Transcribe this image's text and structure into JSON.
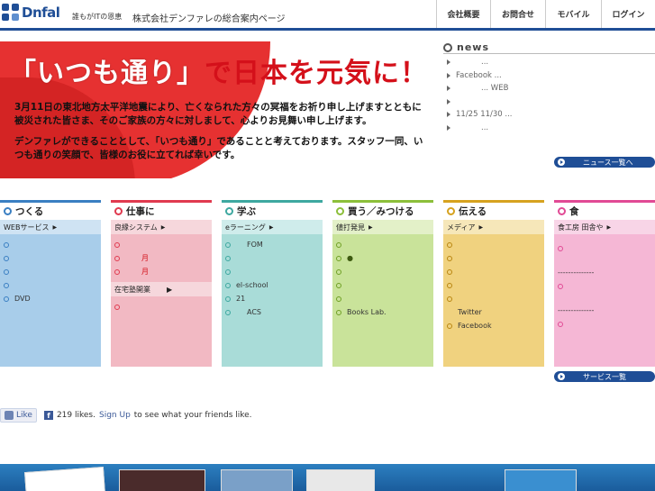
{
  "header": {
    "logo_text": "Dnfal",
    "tagline": "誰もがITの恩恵",
    "site_title": "株式会社デンファレの総合案内ページ",
    "nav": [
      "会社概要",
      "お問合せ",
      "モバイル",
      "ログイン"
    ]
  },
  "hero": {
    "headline_quote": "「いつも通り」",
    "headline_rest": "で日本を元気に！",
    "paragraphs": [
      "3月11日の東北地方太平洋地震により、亡くなられた方々の冥福をお祈り申し上げますとともに被災された皆さま、そのご家族の方々に対しまして、心よりお見舞い申し上げます。",
      "デンファレができることとして、「いつも通り」であることと考えております。スタッフ一同、いつも通りの笑顔で、皆様のお役に立てれば幸いです。"
    ]
  },
  "news": {
    "title": "news",
    "items": [
      "...",
      "Facebook ...",
      "... WEB",
      "",
      "11/25 11/30 ...",
      "..."
    ],
    "more_label": "ニュース一覧へ"
  },
  "columns": [
    {
      "title": "つくる",
      "accent": "#3a7fc2",
      "sub_bg": "#cfe3f3",
      "body_bg": "#a8cdea",
      "sub": "WEBサービス",
      "items": [
        "",
        "",
        "",
        "",
        "DVD"
      ]
    },
    {
      "title": "仕事に",
      "accent": "#e03a4f",
      "sub_bg": "#f6d7dc",
      "body_bg": "#f2b9c3",
      "sub": "良縁システム",
      "items": [
        "",
        "月",
        "月"
      ],
      "sub2": "在宅塾開業",
      "items2": [
        ""
      ]
    },
    {
      "title": "学ぶ",
      "accent": "#3ea8a0",
      "sub_bg": "#cfeceb",
      "body_bg": "#a9dcd8",
      "sub": "eラーニング",
      "items": [
        "FOM",
        "",
        "",
        "el-school",
        "21",
        "ACS"
      ]
    },
    {
      "title": "買う／みつける",
      "accent": "#8cbf3a",
      "sub_bg": "#e3f0c8",
      "body_bg": "#c9e39a",
      "sub": "値打発見",
      "items": [
        "",
        "●",
        "",
        "",
        "",
        "Books Lab."
      ]
    },
    {
      "title": "伝える",
      "accent": "#d6a21f",
      "sub_bg": "#f6e7b9",
      "body_bg": "#f0d27f",
      "sub": "メディア",
      "items": [
        "",
        "",
        "",
        "",
        "",
        "Twitter",
        "Facebook"
      ]
    },
    {
      "title": "食",
      "accent": "#e14a95",
      "sub_bg": "#f8d5e7",
      "body_bg": "#f5b7d5",
      "sub": "食工房 田舎や",
      "items": [
        "",
        "--------------",
        "",
        "--------------",
        ""
      ],
      "more_label": "サービス一覧"
    }
  ],
  "likebar": {
    "like_label": "Like",
    "count_text": "219 likes.",
    "signup": "Sign Up",
    "suffix": "to see what your friends like."
  }
}
